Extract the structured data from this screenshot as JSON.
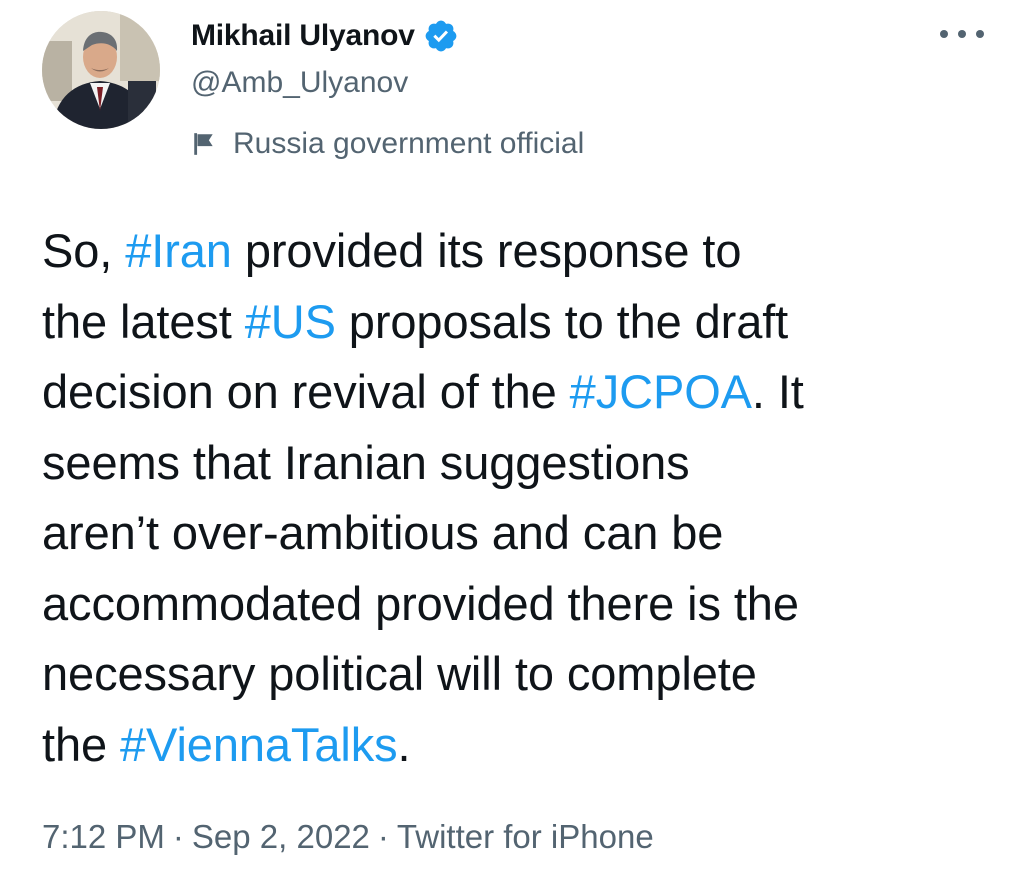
{
  "tweet": {
    "author": {
      "display_name": "Mikhail Ulyanov",
      "handle": "@Amb_Ulyanov",
      "verified": true,
      "label": "Russia government official",
      "avatar_icon": "profile-photo"
    },
    "more_icon": "more-dots-icon",
    "text_lines": [
      [
        {
          "t": "So, "
        },
        {
          "t": "#Iran",
          "tag": true
        },
        {
          "t": " provided its response to"
        }
      ],
      [
        {
          "t": "the latest "
        },
        {
          "t": "#US",
          "tag": true
        },
        {
          "t": " proposals to the draft"
        }
      ],
      [
        {
          "t": "decision on revival of the "
        },
        {
          "t": "#JCPOA",
          "tag": true
        },
        {
          "t": ". It"
        }
      ],
      [
        {
          "t": "seems that Iranian suggestions"
        }
      ],
      [
        {
          "t": "aren’t over-ambitious and can be"
        }
      ],
      [
        {
          "t": "accommodated provided there is the"
        }
      ],
      [
        {
          "t": "necessary political will to complete"
        }
      ],
      [
        {
          "t": "the "
        },
        {
          "t": "#ViennaTalks",
          "tag": true
        },
        {
          "t": "."
        }
      ]
    ],
    "time": "7:12 PM",
    "date": "Sep 2, 2022",
    "separator": "·",
    "source": "Twitter for iPhone"
  },
  "colors": {
    "text": "#0f1419",
    "secondary": "#536471",
    "link": "#1d9bf0",
    "verified": "#1d9bf0"
  }
}
